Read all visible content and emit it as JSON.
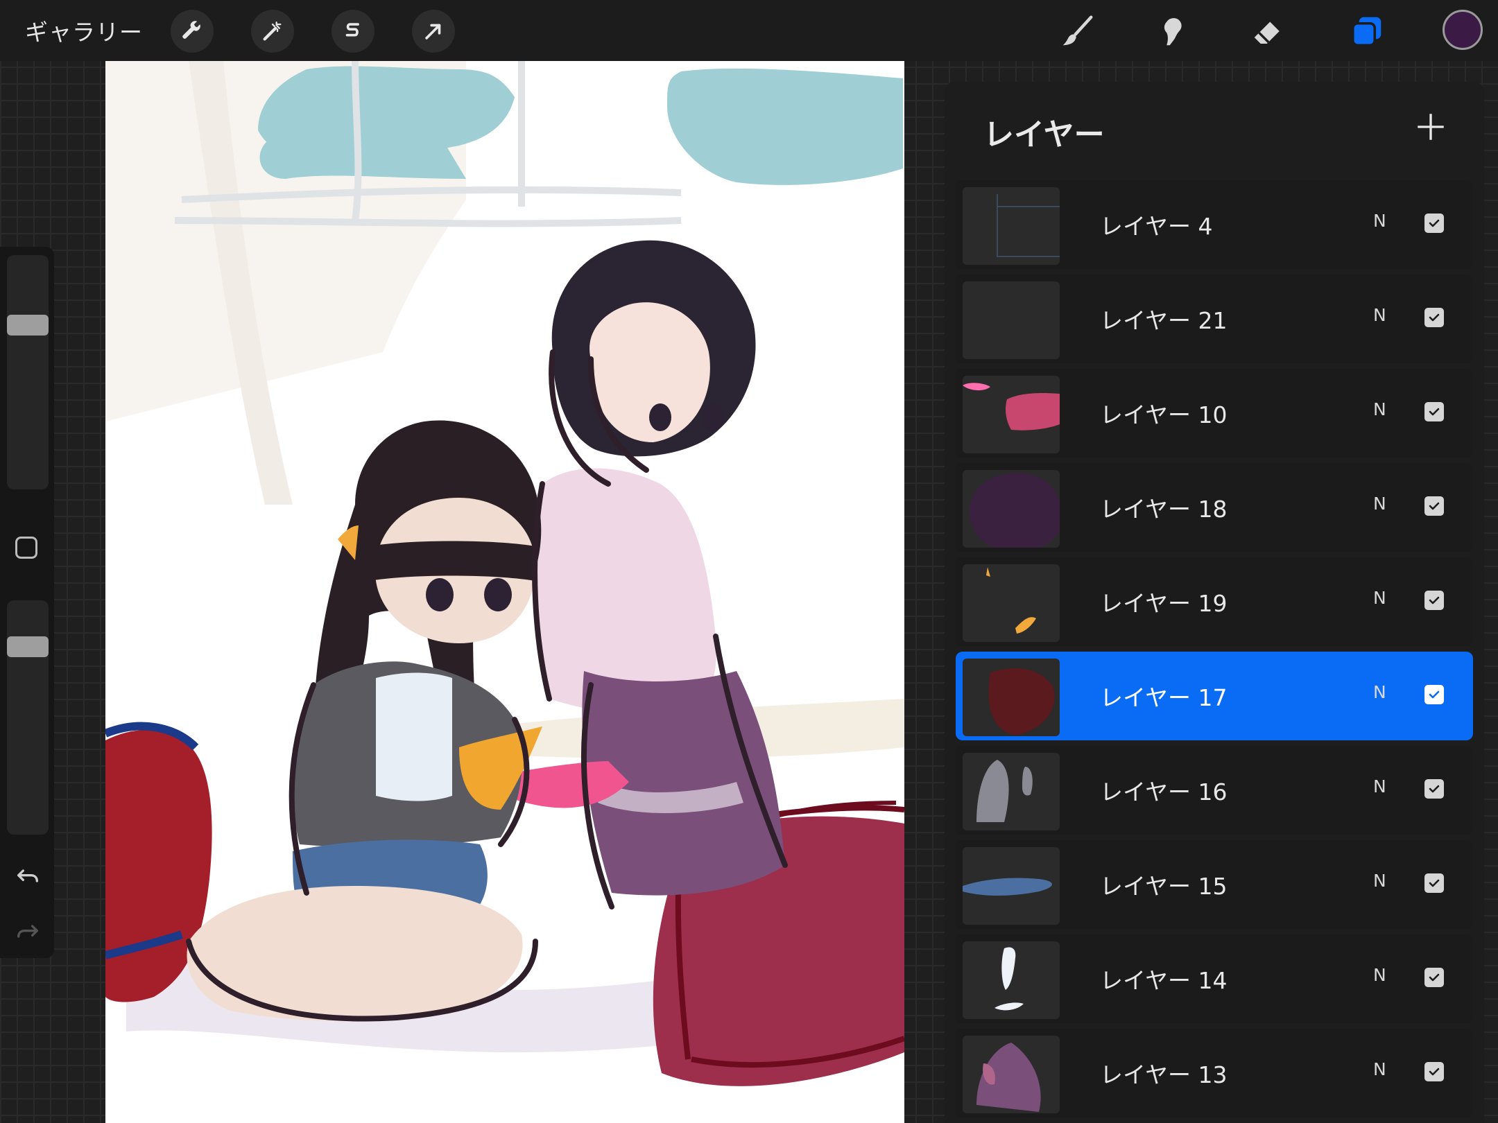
{
  "topbar": {
    "gallery_label": "ギャラリー",
    "left_tools": [
      "wrench-icon",
      "magic-wand-icon",
      "selection-s-icon",
      "arrow-cursor-icon"
    ],
    "right_tools": [
      "brush-icon",
      "smudge-icon",
      "eraser-icon",
      "layers-icon"
    ],
    "current_color": "#3b1b46",
    "active_tool_color": "#0a6cf5"
  },
  "sidebar": {
    "brush_size": 0.28,
    "opacity": 0.06
  },
  "layers": {
    "title": "レイヤー",
    "items": [
      {
        "name": "レイヤー 4",
        "blend": "N",
        "visible": true,
        "selected": false
      },
      {
        "name": "レイヤー 21",
        "blend": "N",
        "visible": true,
        "selected": false
      },
      {
        "name": "レイヤー 10",
        "blend": "N",
        "visible": true,
        "selected": false
      },
      {
        "name": "レイヤー 18",
        "blend": "N",
        "visible": true,
        "selected": false
      },
      {
        "name": "レイヤー 19",
        "blend": "N",
        "visible": true,
        "selected": false
      },
      {
        "name": "レイヤー 17",
        "blend": "N",
        "visible": true,
        "selected": true
      },
      {
        "name": "レイヤー 16",
        "blend": "N",
        "visible": true,
        "selected": false
      },
      {
        "name": "レイヤー 15",
        "blend": "N",
        "visible": true,
        "selected": false
      },
      {
        "name": "レイヤー 14",
        "blend": "N",
        "visible": true,
        "selected": false
      },
      {
        "name": "レイヤー 13",
        "blend": "N",
        "visible": true,
        "selected": false
      }
    ]
  }
}
